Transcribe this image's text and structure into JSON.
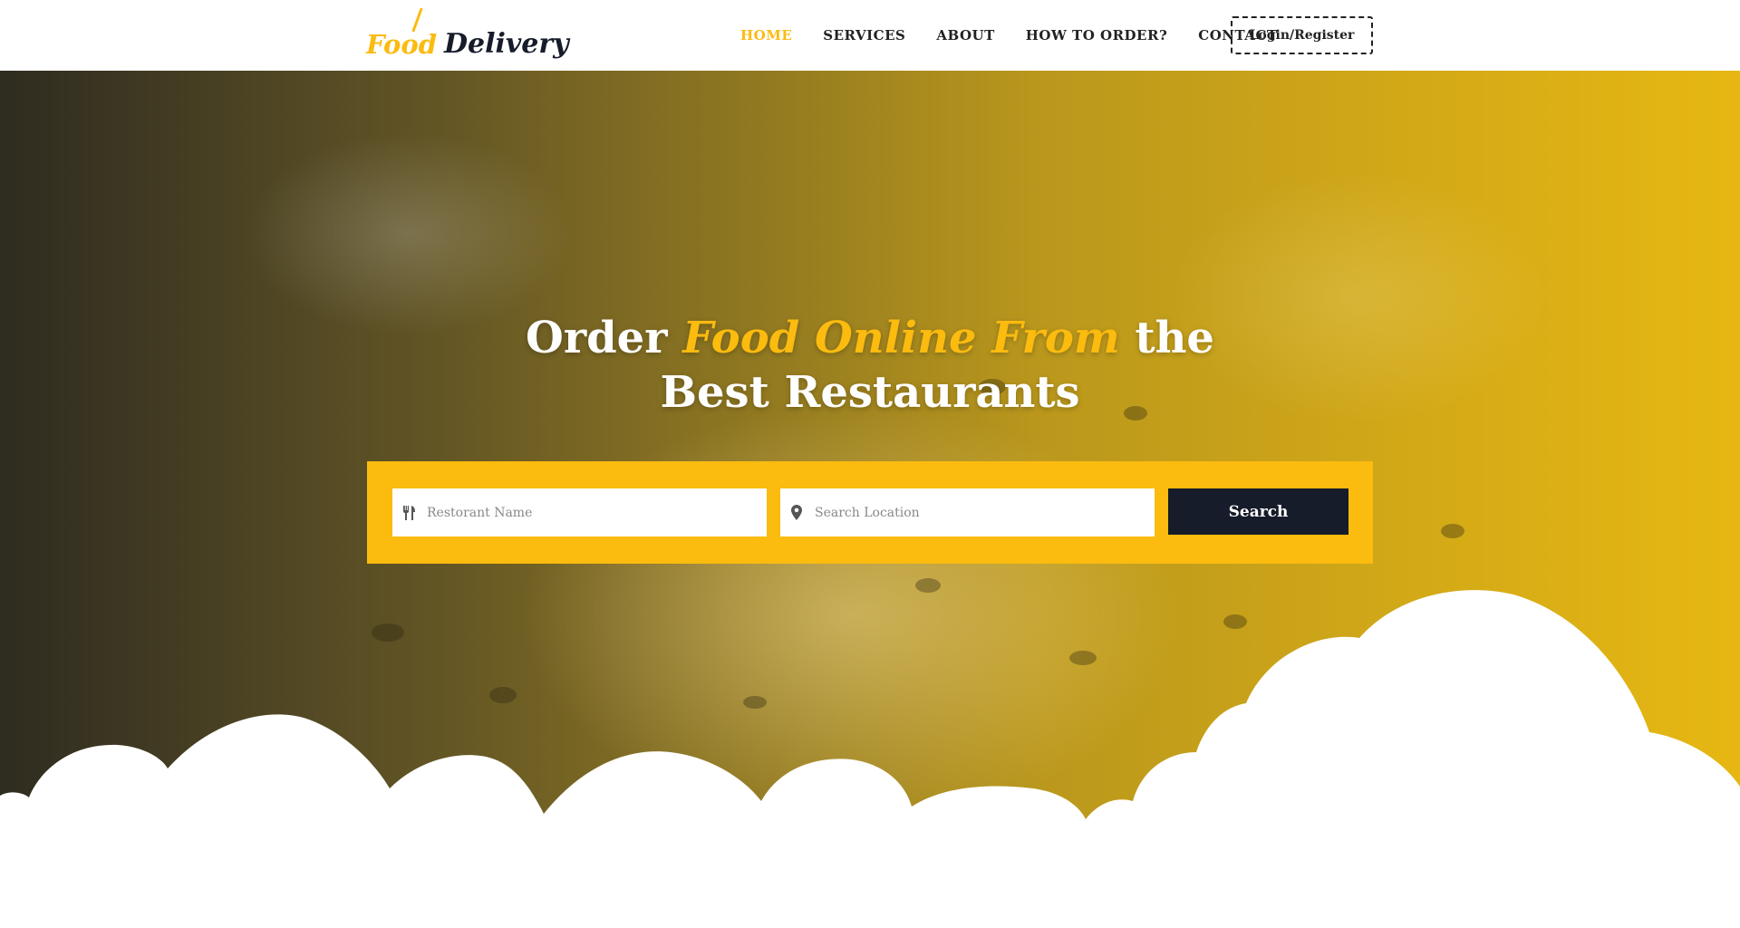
{
  "brand": {
    "logo_word1": "Food",
    "logo_word2": "Delivery",
    "accent_color": "#fbbb0f",
    "dark_color": "#161c2a"
  },
  "nav": {
    "items": [
      {
        "label": "HOME",
        "active": true
      },
      {
        "label": "SERVICES",
        "active": false
      },
      {
        "label": "ABOUT",
        "active": false
      },
      {
        "label": "HOW TO ORDER?",
        "active": false
      },
      {
        "label": "CONTACT",
        "active": false
      }
    ],
    "login_label": "Login/Register"
  },
  "hero": {
    "title_part1": "Order ",
    "title_accent": "Food Online From",
    "title_part2": " the",
    "title_line2": "Best Restaurants"
  },
  "search": {
    "restaurant_placeholder": "Restorant Name",
    "location_placeholder": "Search Location",
    "restaurant_icon": "fork-knife-icon",
    "location_icon": "map-marker-icon",
    "button_label": "Search"
  }
}
